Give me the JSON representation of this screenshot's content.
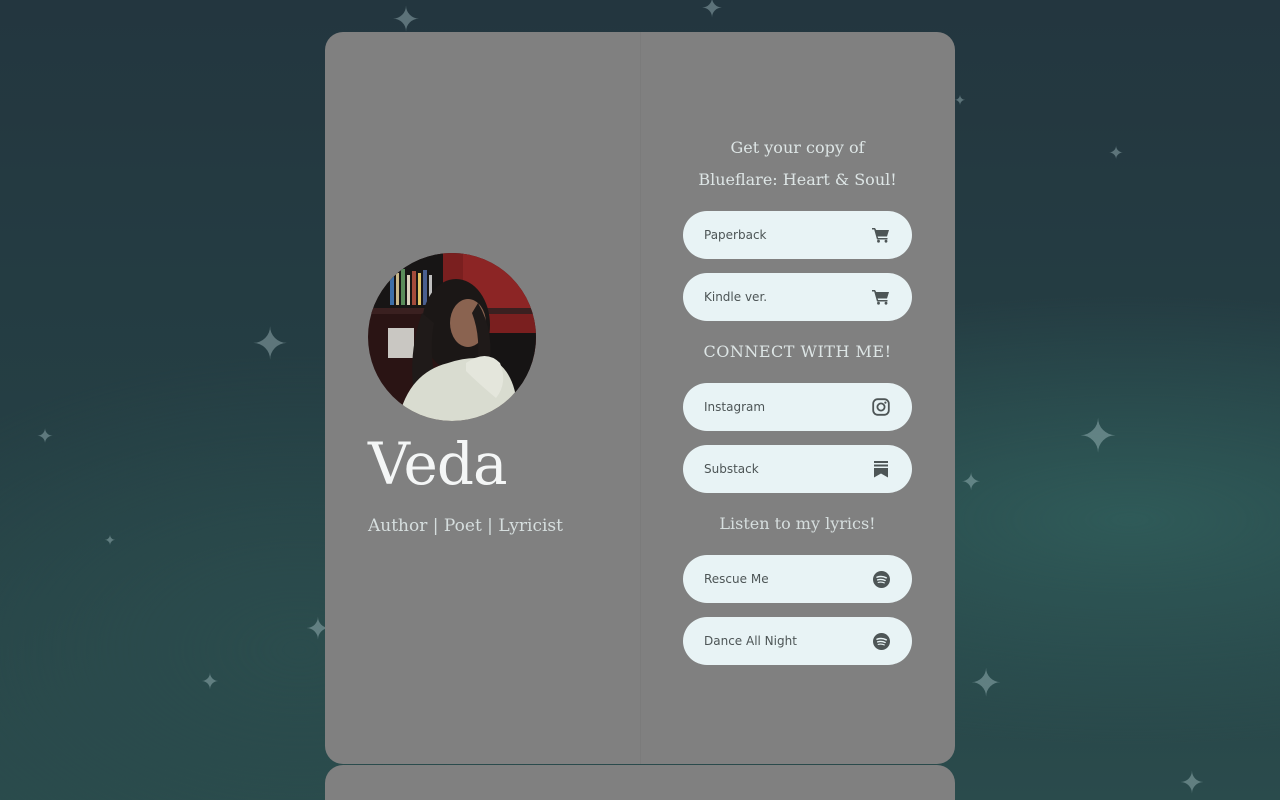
{
  "profile": {
    "name": "Veda",
    "subtitle": "Author | Poet | Lyricist"
  },
  "book": {
    "heading_line1": "Get your copy of",
    "heading_line2": "Blueflare: Heart & Soul!",
    "links": [
      {
        "label": "Paperback",
        "icon": "cart-icon"
      },
      {
        "label": "Kindle ver.",
        "icon": "cart-icon"
      }
    ]
  },
  "connect": {
    "heading": "CONNECT WITH ME!",
    "links": [
      {
        "label": "Instagram",
        "icon": "instagram-icon"
      },
      {
        "label": "Substack",
        "icon": "substack-icon"
      }
    ]
  },
  "lyrics": {
    "heading": "Listen to my lyrics!",
    "links": [
      {
        "label": "Rescue Me",
        "icon": "spotify-icon"
      },
      {
        "label": "Dance All Night",
        "icon": "spotify-icon"
      }
    ]
  },
  "colors": {
    "card": "#808080",
    "button": "#e8f3f5",
    "button_text": "#4d5556",
    "background": "#23363f"
  }
}
